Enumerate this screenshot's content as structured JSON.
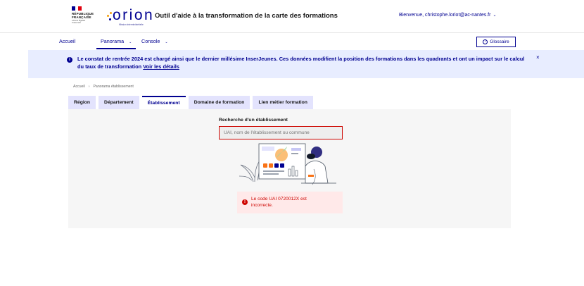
{
  "header": {
    "republic_lines": [
      "RÉPUBLIQUE",
      "FRANÇAISE"
    ],
    "devise": "Liberté Égalité Fraternité",
    "logo_text": "orion",
    "logo_sub": "Mission interministérielle",
    "app_title": "Outil d'aide à la transformation de la carte des formations",
    "welcome": "Bienvenue, christophe.loriot@ac-nantes.fr",
    "colors": {
      "primary": "#000091",
      "flag_blue": "#000091",
      "flag_red": "#e1000f"
    }
  },
  "nav": {
    "items": [
      {
        "label": "Accueil"
      },
      {
        "label": "Panorama",
        "chevron": "chevron-down-icon"
      },
      {
        "label": "Console",
        "chevron": "chevron-down-icon"
      }
    ],
    "active": "Panorama",
    "glossaire": "Glossaire"
  },
  "notice": {
    "text": "Le constat de rentrée 2024 est chargé ainsi que le dernier millésime InserJeunes. Ces données modifient la position des formations dans les quadrants et ont un impact sur le calcul du taux de transformation",
    "link": "Voir les détails",
    "close": "×",
    "icon": "info-icon",
    "color": "#e8edff"
  },
  "breadcrumb": {
    "items": [
      "Accueil",
      "Panorama établissement"
    ],
    "separator": "›"
  },
  "tabs": {
    "items": [
      "Région",
      "Département",
      "Établissement",
      "Domaine de formation",
      "Lien métier formation"
    ],
    "active": "Établissement"
  },
  "search": {
    "label": "Recherche d'un établissement",
    "placeholder": "UAI, nom de l'établissement ou commune",
    "value": ""
  },
  "error": {
    "message": "Le code UAI 0720012X est incorrecte.",
    "icon": "error-icon",
    "color": "#ce0500"
  }
}
